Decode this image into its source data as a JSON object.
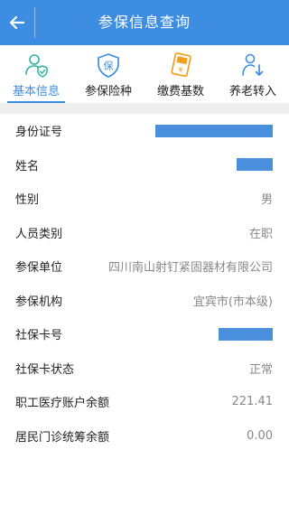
{
  "header": {
    "title": "参保信息查询",
    "back_icon": "arrow-left-icon",
    "background": "#3d8ee2"
  },
  "tabs": [
    {
      "label": "基本信息",
      "icon": "user-shield-icon",
      "active": true
    },
    {
      "label": "参保险种",
      "icon": "insurance-shield-icon",
      "active": false
    },
    {
      "label": "缴费基数",
      "icon": "payment-card-icon",
      "active": false
    },
    {
      "label": "养老转入",
      "icon": "person-transfer-icon",
      "active": false
    }
  ],
  "accent_color": "#3d8ee2",
  "rows": [
    {
      "label": "身份证号",
      "value": "",
      "redacted": true
    },
    {
      "label": "姓名",
      "value": "",
      "redacted": true
    },
    {
      "label": "性别",
      "value": "男"
    },
    {
      "label": "人员类别",
      "value": "在职"
    },
    {
      "label": "参保单位",
      "value": "四川南山射钉紧固器材有限公司"
    },
    {
      "label": "参保机构",
      "value": "宜宾市(市本级)"
    },
    {
      "label": "社保卡号",
      "value": "",
      "redacted": true
    },
    {
      "label": "社保卡状态",
      "value": "正常"
    },
    {
      "label": "职工医疗账户余额",
      "value": "221.41"
    },
    {
      "label": "居民门诊统筹余额",
      "value": "0.00"
    }
  ]
}
